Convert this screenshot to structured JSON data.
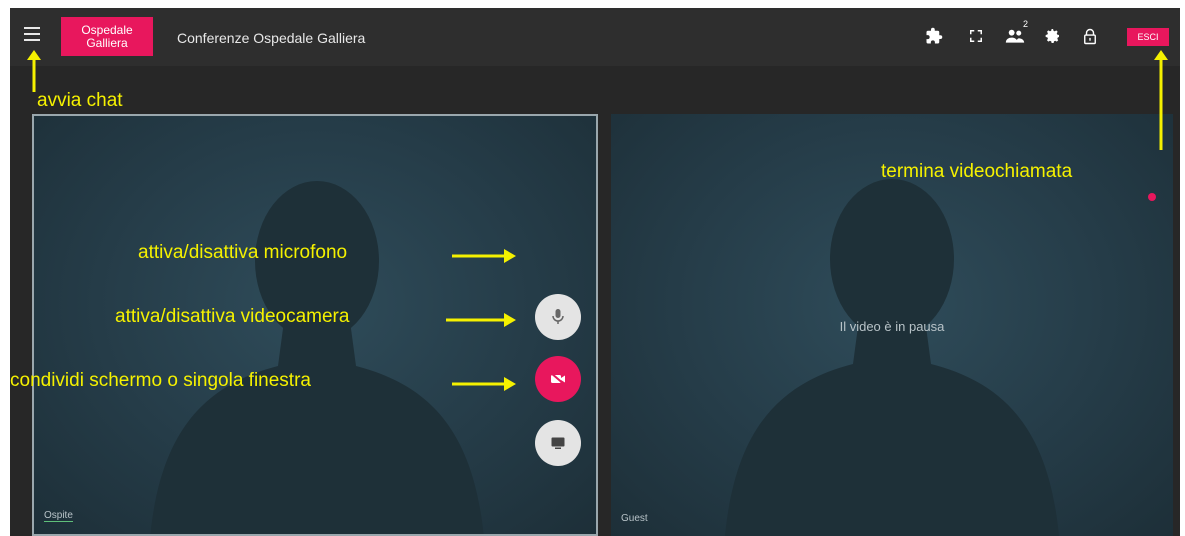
{
  "header": {
    "logo_line1": "Ospedale",
    "logo_line2": "Galliera",
    "title": "Conferenze Ospedale Galliera",
    "participants_count": "2",
    "exit_label": "ESCI",
    "icons": [
      "menu-icon",
      "puzzle-icon",
      "fullscreen-icon",
      "participants-icon",
      "settings-icon",
      "lock-icon"
    ]
  },
  "tiles": {
    "local_name": "Ospite",
    "remote_name": "Guest",
    "remote_status": "Il video è in pausa"
  },
  "controls": {
    "mic_icon": "microphone-icon",
    "camera_icon": "camera-off-icon",
    "screen_icon": "screen-share-icon"
  },
  "annotations": {
    "chat": "avvia chat",
    "end_call": "termina videochiamata",
    "mic": "attiva/disattiva microfono",
    "camera": "attiva/disattiva videocamera",
    "share": "condividi schermo o singola finestra"
  },
  "colors": {
    "accent": "#e8175d",
    "annotation": "#f5f100",
    "tile_bg": "#2f4c5a"
  }
}
